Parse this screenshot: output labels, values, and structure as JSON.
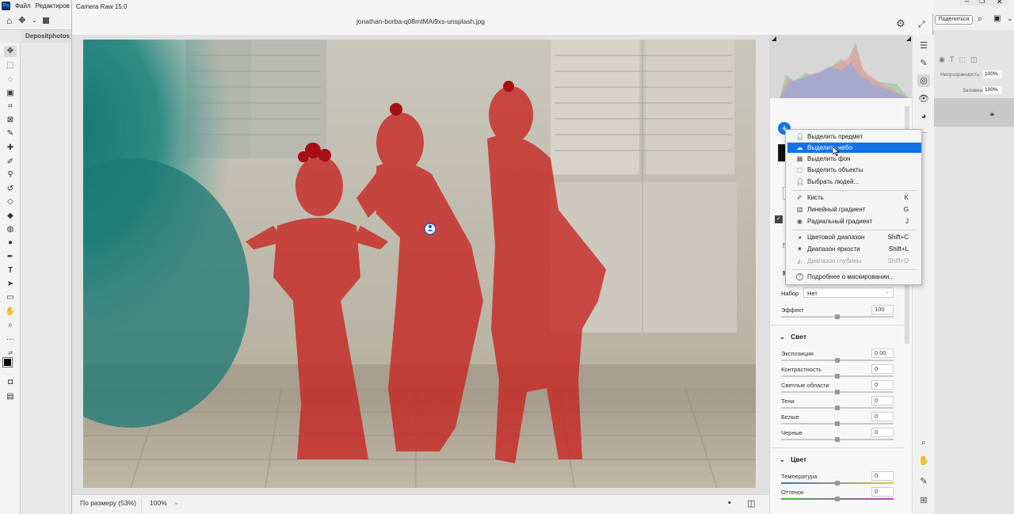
{
  "photoshop": {
    "logo": "Ps",
    "menu": [
      "Файл",
      "Редактиров"
    ],
    "doc_tab": "Depositphotos_",
    "share_label": "Поделиться",
    "opacity_label": "Непрозрачность:",
    "opacity_value": "100%",
    "fill_label": "Заливка:",
    "fill_value": "100%"
  },
  "camera_raw": {
    "window_title": "Camera Raw 15.0",
    "filename": "jonathan-borba-q08mtMAi9xs-unsplash.jpg",
    "zoom_fit_label": "По размеру (53%)",
    "zoom_value": "100%"
  },
  "mask_panel": {
    "preset_label": "Набор",
    "preset_value": "Нет",
    "effect_label": "Эффект",
    "effect_value": "100",
    "light_section": "Свет",
    "light_sliders": [
      {
        "label": "Экспозиция",
        "value": "0.00"
      },
      {
        "label": "Контрастность",
        "value": "0"
      },
      {
        "label": "Светлые области",
        "value": "0"
      },
      {
        "label": "Тени",
        "value": "0"
      },
      {
        "label": "Белые",
        "value": "0"
      },
      {
        "label": "Черные",
        "value": "0"
      }
    ],
    "color_section": "Цвет",
    "color_sliders": [
      {
        "label": "Температура",
        "value": "0"
      },
      {
        "label": "Оттенок",
        "value": "0"
      }
    ]
  },
  "mask_menu": {
    "items": [
      {
        "icon": "person-icon",
        "label": "Выделить предмет",
        "shortcut": ""
      },
      {
        "icon": "sky-icon",
        "label": "Выделить небо",
        "shortcut": "",
        "selected": true
      },
      {
        "icon": "background-icon",
        "label": "Выделить фон",
        "shortcut": ""
      },
      {
        "icon": "objects-icon",
        "label": "Выделить объекты",
        "shortcut": ""
      },
      {
        "icon": "people-icon",
        "label": "Выбрать людей...",
        "shortcut": ""
      },
      {
        "icon": "brush-icon",
        "label": "Кисть",
        "shortcut": "K"
      },
      {
        "icon": "linear-gradient-icon",
        "label": "Линейный градиент",
        "shortcut": "G"
      },
      {
        "icon": "radial-gradient-icon",
        "label": "Радиальный градиент",
        "shortcut": "J"
      },
      {
        "icon": "color-range-icon",
        "label": "Цветовой диапазон",
        "shortcut": "Shift+C"
      },
      {
        "icon": "luminance-range-icon",
        "label": "Диапазон яркости",
        "shortcut": "Shift+L"
      },
      {
        "icon": "depth-range-icon",
        "label": "Диапазон глубины",
        "shortcut": "Shift+D",
        "disabled": true
      },
      {
        "icon": "help-icon",
        "label": "Подробнее о маскировании...",
        "shortcut": ""
      }
    ]
  },
  "colors": {
    "accent": "#1473e6",
    "mask_overlay": "#c8231f",
    "smoke": "#1f7f78"
  }
}
